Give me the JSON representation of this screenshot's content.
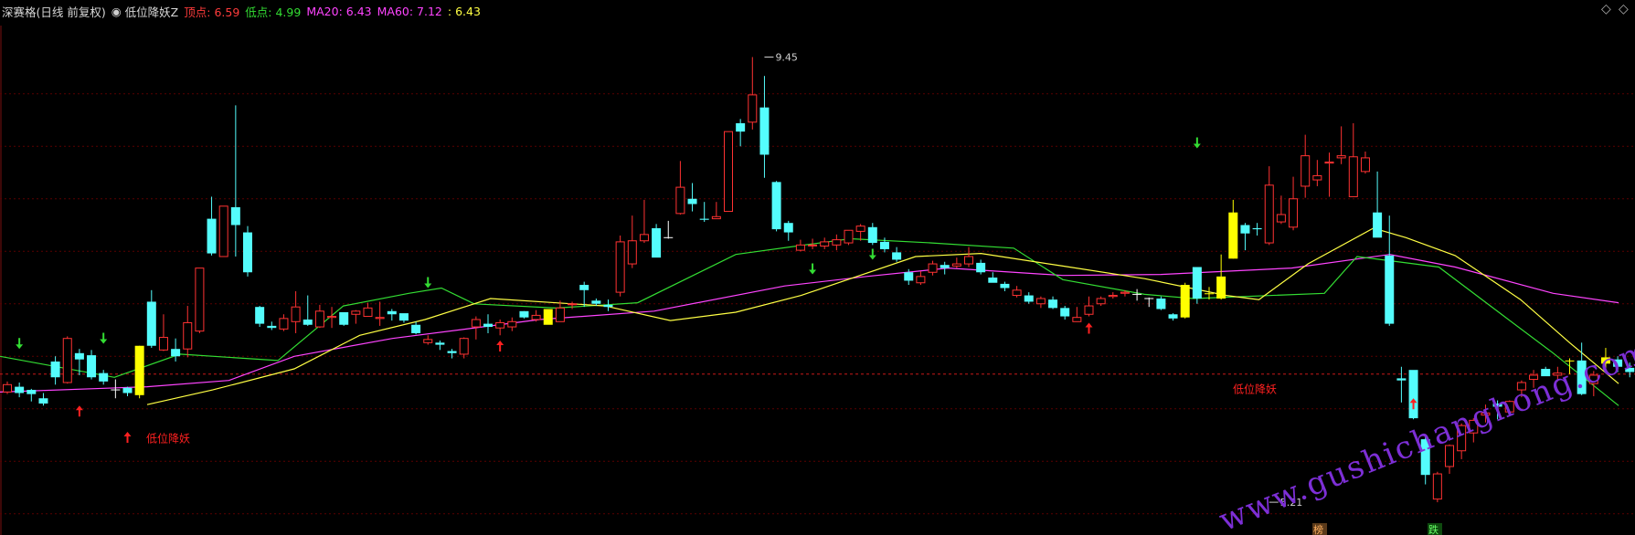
{
  "header": {
    "stock": "深赛格(日线 前复权)",
    "indicator": "低位降妖Z",
    "items": [
      {
        "label": "顶点:",
        "value": "6.59",
        "color": "#ff3c3c"
      },
      {
        "label": "低点:",
        "value": "4.99",
        "color": "#33dd33"
      },
      {
        "label": "MA20:",
        "value": "6.43",
        "color": "#ff44ff"
      },
      {
        "label": "MA60:",
        "value": "7.12",
        "color": "#ff44ff"
      },
      {
        "label": ":",
        "value": "6.43",
        "color": "#ffff44"
      }
    ]
  },
  "controls": {
    "collapse": "◇",
    "expand": "◇"
  },
  "watermark": "www.gushichanghong.com",
  "chart_data": {
    "type": "candlestick",
    "ylim": [
      4.95,
      9.75
    ],
    "reference_line": 6.43,
    "colors": {
      "up": "#ff3232",
      "down": "#54fcfc",
      "signal": "#ffff00",
      "ma_yellow": "#ffff44",
      "ma_green": "#33dd33",
      "ma_magenta": "#ff44ff"
    },
    "annotations": {
      "high": "9.45",
      "low": "5.21",
      "label_text": "低位降妖",
      "badge1": "榜",
      "badge2": "跌"
    },
    "candles": [
      [
        6.26,
        6.33,
        6.36,
        6.24,
        "u"
      ],
      [
        6.31,
        6.25,
        6.35,
        6.21,
        "d"
      ],
      [
        6.28,
        6.24,
        6.29,
        6.17,
        "d"
      ],
      [
        6.2,
        6.15,
        6.25,
        6.13,
        "d"
      ],
      [
        6.4,
        6.55,
        6.6,
        6.33,
        "d"
      ],
      [
        6.35,
        6.77,
        6.79,
        6.34,
        "u"
      ],
      [
        6.63,
        6.57,
        6.67,
        6.42,
        "d"
      ],
      [
        6.61,
        6.4,
        6.66,
        6.38,
        "d"
      ],
      [
        6.44,
        6.36,
        6.47,
        6.33,
        "d"
      ],
      [
        6.28,
        6.28,
        6.38,
        6.2,
        "x"
      ],
      [
        6.3,
        6.25,
        6.31,
        6.22,
        "d"
      ],
      [
        6.23,
        6.7,
        6.7,
        6.2,
        "s"
      ],
      [
        7.12,
        6.7,
        7.23,
        6.68,
        "d"
      ],
      [
        6.66,
        6.78,
        7.0,
        6.65,
        "u"
      ],
      [
        6.67,
        6.6,
        6.77,
        6.55,
        "d"
      ],
      [
        6.67,
        6.92,
        7.08,
        6.59,
        "u"
      ],
      [
        6.84,
        7.44,
        7.44,
        6.82,
        "u"
      ],
      [
        7.91,
        7.58,
        8.12,
        7.56,
        "d"
      ],
      [
        7.55,
        8.03,
        8.03,
        7.55,
        "u"
      ],
      [
        7.85,
        8.02,
        8.99,
        7.55,
        "d"
      ],
      [
        7.78,
        7.4,
        7.84,
        7.36,
        "d"
      ],
      [
        7.07,
        6.91,
        7.08,
        6.88,
        "d"
      ],
      [
        6.89,
        6.87,
        6.93,
        6.85,
        "d"
      ],
      [
        6.86,
        6.96,
        7.0,
        6.84,
        "u"
      ],
      [
        6.93,
        7.07,
        7.22,
        6.82,
        "u"
      ],
      [
        6.95,
        6.9,
        7.18,
        6.89,
        "d"
      ],
      [
        6.88,
        7.03,
        7.09,
        6.87,
        "u"
      ],
      [
        6.98,
        6.97,
        7.07,
        6.87,
        "u"
      ],
      [
        7.02,
        6.9,
        7.0,
        6.89,
        "d"
      ],
      [
        7.03,
        7.0,
        7.04,
        6.91,
        "u"
      ],
      [
        6.98,
        7.06,
        7.11,
        6.98,
        "u"
      ],
      [
        6.96,
        6.97,
        7.12,
        6.89,
        "u"
      ],
      [
        7.03,
        7.0,
        7.05,
        6.94,
        "d"
      ],
      [
        7.01,
        6.94,
        7.0,
        6.92,
        "d"
      ],
      [
        6.9,
        6.82,
        6.93,
        6.81,
        "d"
      ],
      [
        6.76,
        6.73,
        6.8,
        6.71,
        "u"
      ],
      [
        6.73,
        6.71,
        6.75,
        6.66,
        "d"
      ],
      [
        6.65,
        6.63,
        6.67,
        6.58,
        "d"
      ],
      [
        6.62,
        6.77,
        6.78,
        6.58,
        "u"
      ],
      [
        6.88,
        6.95,
        6.98,
        6.76,
        "u"
      ],
      [
        6.91,
        6.88,
        7.0,
        6.82,
        "d"
      ],
      [
        6.87,
        6.92,
        6.95,
        6.8,
        "u"
      ],
      [
        6.88,
        6.93,
        6.97,
        6.84,
        "u"
      ],
      [
        7.03,
        6.97,
        7.03,
        6.96,
        "d"
      ],
      [
        6.95,
        6.99,
        7.04,
        6.93,
        "u"
      ],
      [
        7.05,
        6.9,
        7.05,
        6.93,
        "s"
      ],
      [
        6.93,
        7.06,
        7.13,
        6.93,
        "u"
      ],
      [
        7.1,
        7.1,
        7.12,
        7.05,
        "u"
      ],
      [
        7.28,
        7.23,
        7.31,
        7.07,
        "d"
      ],
      [
        7.13,
        7.1,
        7.15,
        7.08,
        "d"
      ],
      [
        7.09,
        7.07,
        7.14,
        7.03,
        "d"
      ],
      [
        7.21,
        7.69,
        7.75,
        7.17,
        "u"
      ],
      [
        7.48,
        7.7,
        7.94,
        7.44,
        "u"
      ],
      [
        7.7,
        7.76,
        8.09,
        7.68,
        "u"
      ],
      [
        7.54,
        7.82,
        7.86,
        7.65,
        "d"
      ],
      [
        7.72,
        7.73,
        7.89,
        7.72,
        "x"
      ],
      [
        7.96,
        8.21,
        8.46,
        7.95,
        "u"
      ],
      [
        8.1,
        8.05,
        8.25,
        7.98,
        "d"
      ],
      [
        7.9,
        7.91,
        8.07,
        7.88,
        "d"
      ],
      [
        7.91,
        7.93,
        8.07,
        7.91,
        "u"
      ],
      [
        7.98,
        8.74,
        8.74,
        7.98,
        "u"
      ],
      [
        8.82,
        8.74,
        8.86,
        8.6,
        "d"
      ],
      [
        9.09,
        8.83,
        9.45,
        8.76,
        "u"
      ],
      [
        8.97,
        8.52,
        9.27,
        8.3,
        "d"
      ],
      [
        8.26,
        7.81,
        8.27,
        7.79,
        "d"
      ],
      [
        7.87,
        7.78,
        7.89,
        7.7,
        "d"
      ],
      [
        7.66,
        7.61,
        7.71,
        7.6,
        "u"
      ],
      [
        7.66,
        7.66,
        7.72,
        7.62,
        "u"
      ],
      [
        7.65,
        7.69,
        7.73,
        7.62,
        "u"
      ],
      [
        7.71,
        7.66,
        7.76,
        7.61,
        "u"
      ],
      [
        7.68,
        7.8,
        7.8,
        7.66,
        "u"
      ],
      [
        7.79,
        7.84,
        7.86,
        7.7,
        "u"
      ],
      [
        7.83,
        7.68,
        7.87,
        7.66,
        "d"
      ],
      [
        7.69,
        7.62,
        7.73,
        7.59,
        "d"
      ],
      [
        7.59,
        7.52,
        7.64,
        7.5,
        "d"
      ],
      [
        7.4,
        7.32,
        7.43,
        7.28,
        "d"
      ],
      [
        7.3,
        7.36,
        7.41,
        7.28,
        "u"
      ],
      [
        7.4,
        7.48,
        7.51,
        7.37,
        "u"
      ],
      [
        7.47,
        7.44,
        7.5,
        7.38,
        "d"
      ],
      [
        7.46,
        7.48,
        7.54,
        7.44,
        "u"
      ],
      [
        7.55,
        7.48,
        7.64,
        7.45,
        "u"
      ],
      [
        7.49,
        7.4,
        7.52,
        7.38,
        "d"
      ],
      [
        7.35,
        7.3,
        7.4,
        7.32,
        "d"
      ],
      [
        7.29,
        7.25,
        7.31,
        7.22,
        "d"
      ],
      [
        7.23,
        7.18,
        7.27,
        7.16,
        "u"
      ],
      [
        7.18,
        7.12,
        7.21,
        7.1,
        "d"
      ],
      [
        7.15,
        7.1,
        7.17,
        7.06,
        "u"
      ],
      [
        7.14,
        7.06,
        7.17,
        7.05,
        "d"
      ],
      [
        7.06,
        6.98,
        7.08,
        6.95,
        "d"
      ],
      [
        6.93,
        6.97,
        7.07,
        6.93,
        "u"
      ],
      [
        7.0,
        7.08,
        7.17,
        6.98,
        "u"
      ],
      [
        7.1,
        7.15,
        7.17,
        7.08,
        "u"
      ],
      [
        7.17,
        7.18,
        7.21,
        7.15,
        "u"
      ],
      [
        7.2,
        7.21,
        7.23,
        7.17,
        "u"
      ],
      [
        7.19,
        7.19,
        7.24,
        7.13,
        "x"
      ],
      [
        7.15,
        7.15,
        7.16,
        7.07,
        "x"
      ],
      [
        7.15,
        7.05,
        7.17,
        7.04,
        "d"
      ],
      [
        7.0,
        6.96,
        7.01,
        6.94,
        "d"
      ],
      [
        6.97,
        7.28,
        7.3,
        6.96,
        "s"
      ],
      [
        7.45,
        7.15,
        7.39,
        7.1,
        "d"
      ],
      [
        7.2,
        7.2,
        7.26,
        7.14,
        "s"
      ],
      [
        7.15,
        7.36,
        7.57,
        7.14,
        "s"
      ],
      [
        7.53,
        7.97,
        8.09,
        7.53,
        "s"
      ],
      [
        7.85,
        7.77,
        7.87,
        7.61,
        "d"
      ],
      [
        7.82,
        7.81,
        7.87,
        7.75,
        "d"
      ],
      [
        7.68,
        8.23,
        8.41,
        7.66,
        "u"
      ],
      [
        7.88,
        7.95,
        8.13,
        7.86,
        "u"
      ],
      [
        7.83,
        8.1,
        8.31,
        7.8,
        "u"
      ],
      [
        8.22,
        8.51,
        8.71,
        8.11,
        "u"
      ],
      [
        8.28,
        8.32,
        8.47,
        8.22,
        "u"
      ],
      [
        8.44,
        8.45,
        8.54,
        8.12,
        "u"
      ],
      [
        8.49,
        8.51,
        8.79,
        8.43,
        "u"
      ],
      [
        8.5,
        8.12,
        8.82,
        8.44,
        "u"
      ],
      [
        8.36,
        8.49,
        8.55,
        8.34,
        "u"
      ],
      [
        7.97,
        7.73,
        8.36,
        7.75,
        "d"
      ],
      [
        7.56,
        6.91,
        7.94,
        6.89,
        "d"
      ],
      [
        6.39,
        6.37,
        6.5,
        6.16,
        "d"
      ],
      [
        6.47,
        6.01,
        6.45,
        6.0,
        "d"
      ],
      [
        5.81,
        5.47,
        5.85,
        5.38,
        "d"
      ],
      [
        5.48,
        5.24,
        5.5,
        5.21,
        "u"
      ],
      [
        5.55,
        5.75,
        5.76,
        5.48,
        "u"
      ],
      [
        5.7,
        5.94,
        5.96,
        5.62,
        "u"
      ],
      [
        5.87,
        5.99,
        6.01,
        5.78,
        "u"
      ],
      [
        6.04,
        6.06,
        6.14,
        5.97,
        "u"
      ],
      [
        6.12,
        6.15,
        6.18,
        6.0,
        "d"
      ],
      [
        6.07,
        6.17,
        6.18,
        6.04,
        "u"
      ],
      [
        6.28,
        6.35,
        6.37,
        6.21,
        "u"
      ],
      [
        6.42,
        6.38,
        6.47,
        6.3,
        "u"
      ],
      [
        6.48,
        6.41,
        6.5,
        6.44,
        "d"
      ],
      [
        6.42,
        6.44,
        6.5,
        6.36,
        "u"
      ],
      [
        6.56,
        6.56,
        6.58,
        6.43,
        "s"
      ],
      [
        6.56,
        6.24,
        6.73,
        6.23,
        "d"
      ],
      [
        6.42,
        6.34,
        6.46,
        6.22,
        "u"
      ],
      [
        6.59,
        6.53,
        6.68,
        6.48,
        "s"
      ],
      [
        6.57,
        6.5,
        6.6,
        6.45,
        "d"
      ],
      [
        6.49,
        6.45,
        6.54,
        6.4,
        "d"
      ]
    ],
    "ma_yellow": [
      [
        0.09,
        6.14
      ],
      [
        0.13,
        6.28
      ],
      [
        0.18,
        6.48
      ],
      [
        0.22,
        6.8
      ],
      [
        0.26,
        6.95
      ],
      [
        0.3,
        7.15
      ],
      [
        0.37,
        7.08
      ],
      [
        0.41,
        6.94
      ],
      [
        0.45,
        7.02
      ],
      [
        0.49,
        7.18
      ],
      [
        0.56,
        7.55
      ],
      [
        0.6,
        7.58
      ],
      [
        0.65,
        7.46
      ],
      [
        0.7,
        7.34
      ],
      [
        0.75,
        7.18
      ],
      [
        0.77,
        7.14
      ],
      [
        0.8,
        7.48
      ],
      [
        0.84,
        7.82
      ],
      [
        0.86,
        7.73
      ],
      [
        0.89,
        7.56
      ],
      [
        0.93,
        7.14
      ],
      [
        0.96,
        6.73
      ],
      [
        0.99,
        6.34
      ]
    ],
    "ma_green": [
      [
        0.0,
        6.6
      ],
      [
        0.07,
        6.4
      ],
      [
        0.11,
        6.62
      ],
      [
        0.17,
        6.56
      ],
      [
        0.21,
        7.08
      ],
      [
        0.25,
        7.2
      ],
      [
        0.27,
        7.25
      ],
      [
        0.29,
        7.1
      ],
      [
        0.34,
        7.06
      ],
      [
        0.39,
        7.11
      ],
      [
        0.45,
        7.57
      ],
      [
        0.52,
        7.72
      ],
      [
        0.57,
        7.68
      ],
      [
        0.62,
        7.63
      ],
      [
        0.65,
        7.33
      ],
      [
        0.7,
        7.19
      ],
      [
        0.73,
        7.15
      ],
      [
        0.81,
        7.2
      ],
      [
        0.83,
        7.55
      ],
      [
        0.88,
        7.45
      ],
      [
        0.92,
        6.98
      ],
      [
        0.95,
        6.63
      ],
      [
        0.99,
        6.13
      ]
    ],
    "ma_magenta": [
      [
        0.0,
        6.26
      ],
      [
        0.09,
        6.31
      ],
      [
        0.14,
        6.37
      ],
      [
        0.18,
        6.6
      ],
      [
        0.24,
        6.77
      ],
      [
        0.33,
        6.95
      ],
      [
        0.4,
        7.03
      ],
      [
        0.48,
        7.27
      ],
      [
        0.53,
        7.36
      ],
      [
        0.58,
        7.44
      ],
      [
        0.65,
        7.37
      ],
      [
        0.71,
        7.38
      ],
      [
        0.79,
        7.44
      ],
      [
        0.85,
        7.57
      ],
      [
        0.89,
        7.45
      ],
      [
        0.95,
        7.2
      ],
      [
        0.99,
        7.11
      ]
    ]
  }
}
